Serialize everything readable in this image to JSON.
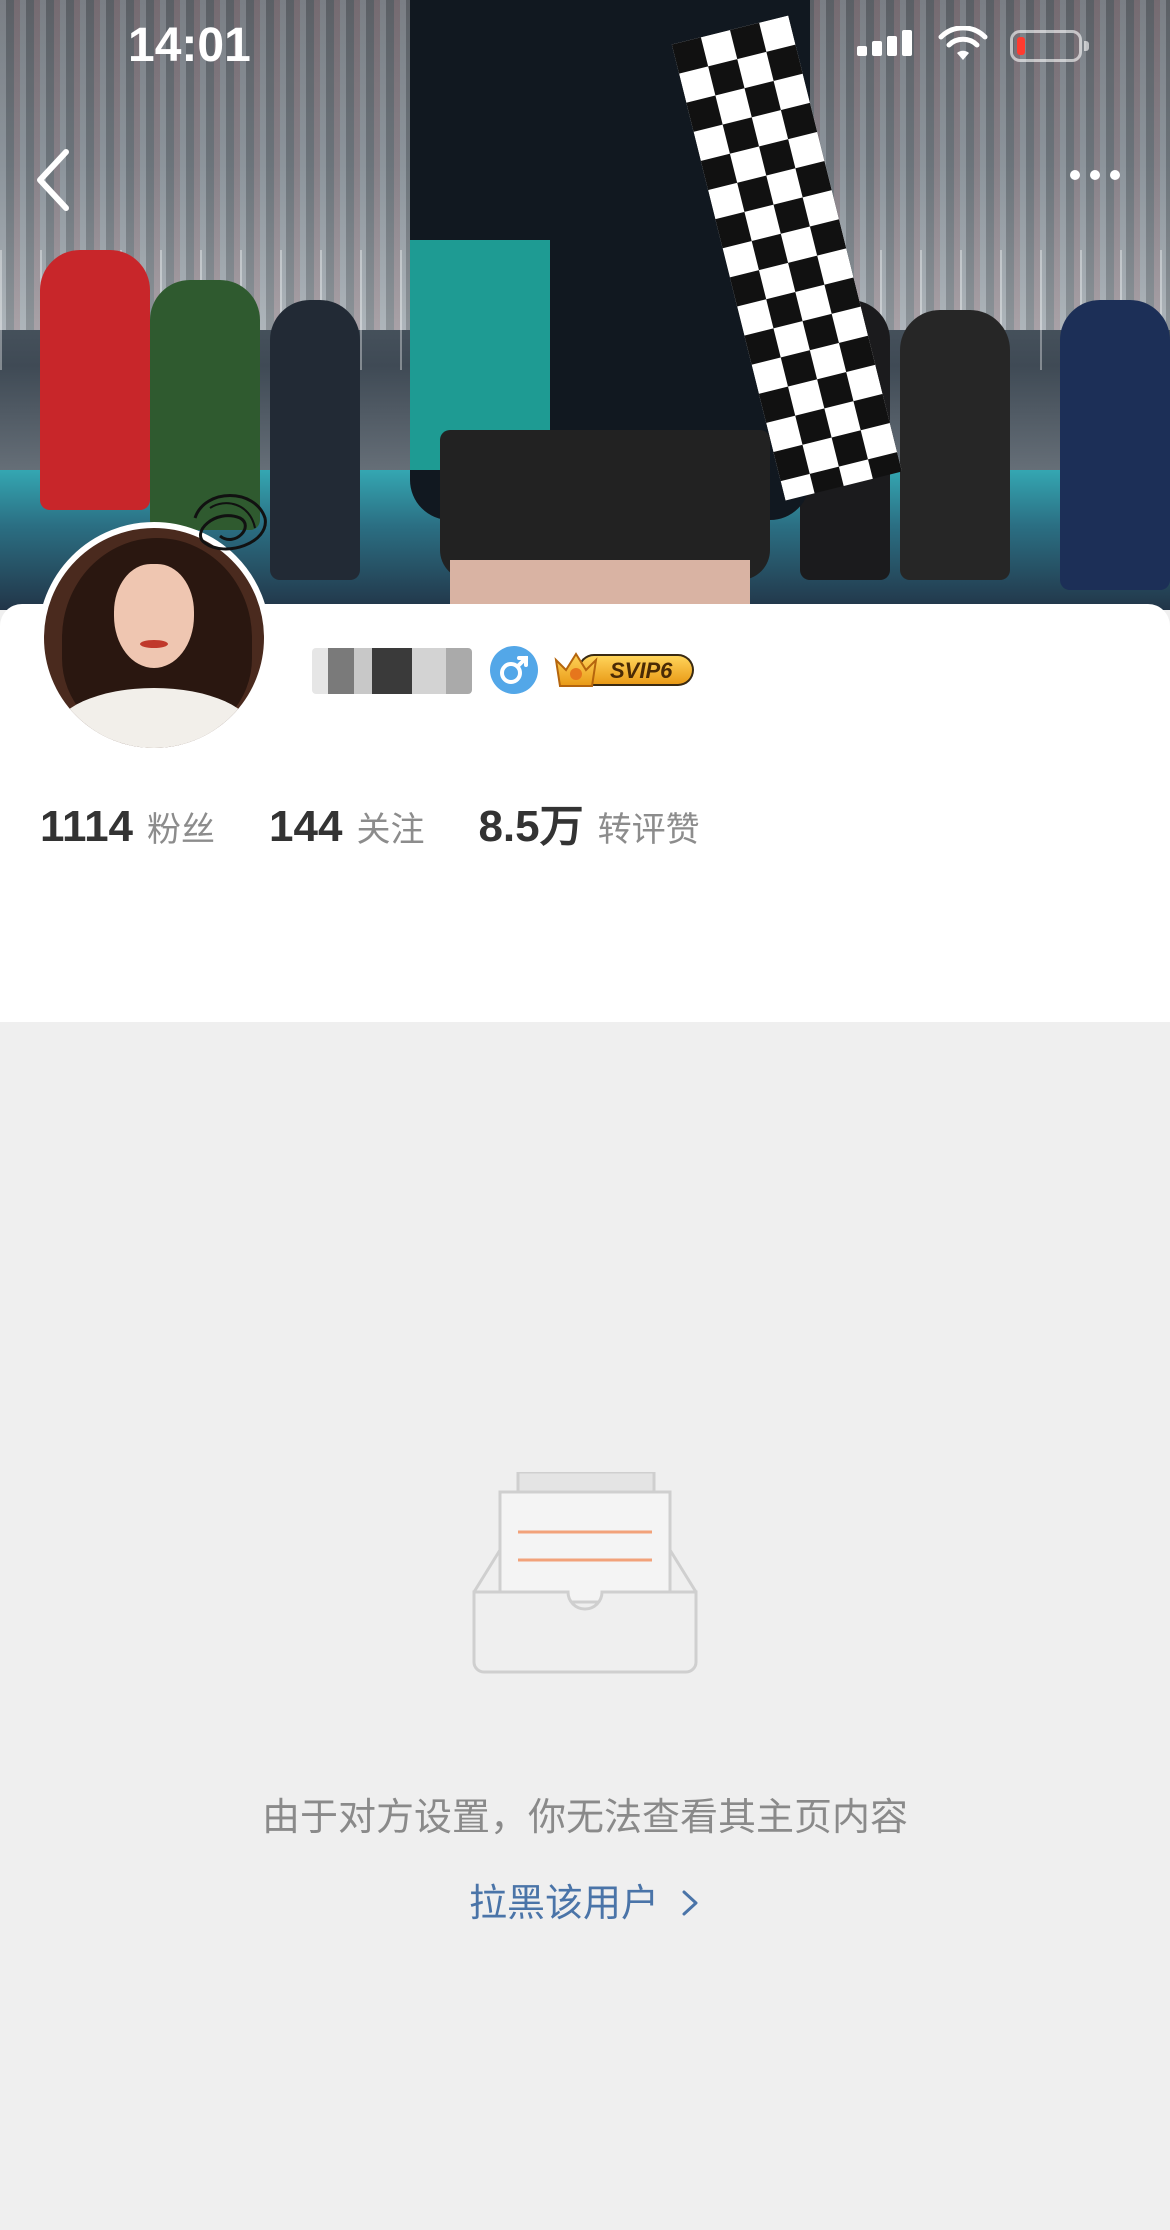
{
  "status_bar": {
    "time": "14:01"
  },
  "header": {
    "back_icon": "chevron-left-icon",
    "more_icon": "ellipsis-icon"
  },
  "profile": {
    "username": "",
    "gender_icon": "male-icon",
    "vip_badge": "SVIP6",
    "stats": [
      {
        "value": "1114",
        "label": "粉丝"
      },
      {
        "value": "144",
        "label": "关注"
      },
      {
        "value": "8.5万",
        "label": "转评赞"
      }
    ]
  },
  "empty_state": {
    "icon": "empty-box-icon",
    "message": "由于对方设置，你无法查看其主页内容",
    "action_label": "拉黑该用户",
    "action_icon": "chevron-right-icon"
  },
  "colors": {
    "link": "#4a74a8",
    "gender_badge": "#53a7e8",
    "vip_gold": "#f2b233",
    "background": "#efefef"
  }
}
